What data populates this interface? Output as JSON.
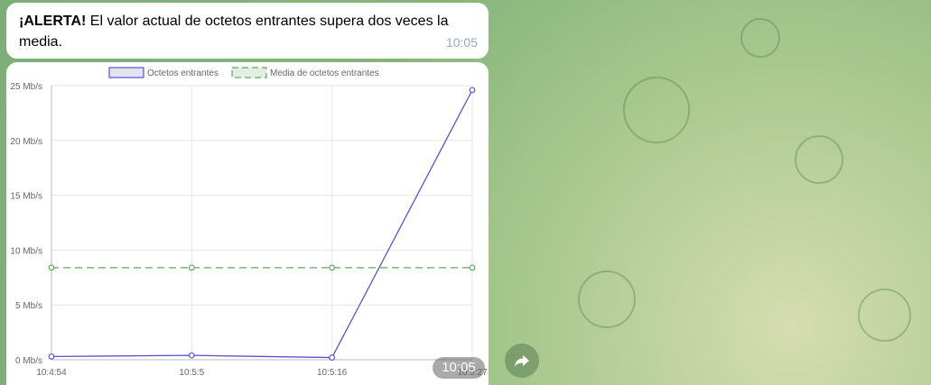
{
  "message": {
    "alert_bold": "¡ALERTA!",
    "text": " El valor actual de octetos entrantes supera dos veces la media.",
    "time": "10:05"
  },
  "photo": {
    "time": "10:05"
  },
  "chart_data": {
    "type": "line",
    "categories": [
      "10:4:54",
      "10:5:5",
      "10:5:16",
      "10:5:27"
    ],
    "series": [
      {
        "name": "Octetos entrantes",
        "values": [
          0.3,
          0.4,
          0.2,
          24.6
        ],
        "color": "#5454d8",
        "dashed": false
      },
      {
        "name": "Media de octetos entrantes",
        "values": [
          8.4,
          8.4,
          8.4,
          8.4
        ],
        "color": "#5aa95a",
        "dashed": true
      }
    ],
    "ylim": [
      0,
      25
    ],
    "yticks": [
      "0 Mb/s",
      "5 Mb/s",
      "10 Mb/s",
      "15 Mb/s",
      "20 Mb/s",
      "25 Mb/s"
    ],
    "grid": true,
    "legend": "top"
  }
}
